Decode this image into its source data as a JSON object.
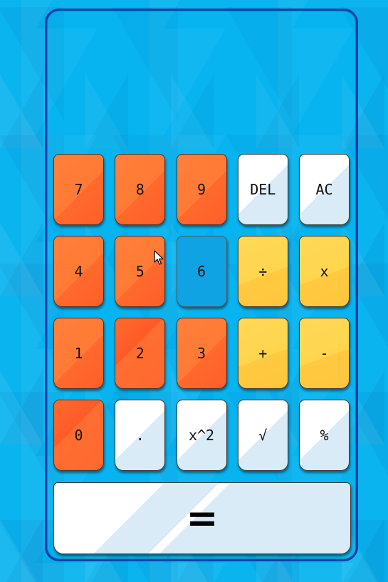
{
  "display": {
    "value": ""
  },
  "keys": [
    {
      "label": "7",
      "style": "orange"
    },
    {
      "label": "8",
      "style": "orange"
    },
    {
      "label": "9",
      "style": "orange"
    },
    {
      "label": "DEL",
      "style": "white"
    },
    {
      "label": "AC",
      "style": "white"
    },
    {
      "label": "4",
      "style": "orange"
    },
    {
      "label": "5",
      "style": "orange"
    },
    {
      "label": "6",
      "style": "blue"
    },
    {
      "label": "÷",
      "style": "yellow"
    },
    {
      "label": "x",
      "style": "yellow"
    },
    {
      "label": "1",
      "style": "orange"
    },
    {
      "label": "2",
      "style": "orange dark"
    },
    {
      "label": "3",
      "style": "orange"
    },
    {
      "label": "+",
      "style": "yellow"
    },
    {
      "label": "-",
      "style": "yellow"
    },
    {
      "label": "0",
      "style": "orange dark"
    },
    {
      "label": ".",
      "style": "white"
    },
    {
      "label": "x^2",
      "style": "white"
    },
    {
      "label": "√",
      "style": "white"
    },
    {
      "label": "%",
      "style": "white"
    }
  ],
  "equals": {
    "label": "="
  },
  "colors": {
    "background": "#0ab4ef",
    "frame_border": "#0a3fa8",
    "orange": "#ff7f3a",
    "yellow": "#ffd54f",
    "white": "#ffffff",
    "blue": "#0fa3e3"
  },
  "icons": {
    "cursor": "mouse-pointer-icon"
  }
}
